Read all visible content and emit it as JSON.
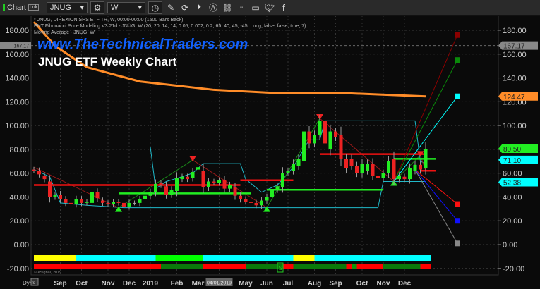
{
  "toolbar": {
    "window_title": "Chart",
    "link_badge": "Lnk",
    "symbol": "JNUG",
    "interval": "W",
    "icons": [
      "settings-icon",
      "clock-icon",
      "pencil-icon",
      "refresh-icon",
      "play-icon",
      "alert-icon",
      "link-icon",
      "options-icon",
      "chat-icon",
      "twitter-icon",
      "facebook-icon"
    ]
  },
  "header": {
    "line1": "* JNUG, DIREXION SHS ETF TR, W, 00:00-00:00 (1500 Bars Back)",
    "line2": "ENT Fibonacci Price Modeling V3.21d - JNUG, W (20, 20, 14, 14, 0.05, 0.002, 0.2, 65, 40, 45, -45, Long, false, false, true, 7)",
    "line3": "Moving Average - JNUG, W",
    "watermark": "www.TheTechnicalTraders.com",
    "title": "JNUG ETF Weekly Chart",
    "copyright": "© eSignal, 2019"
  },
  "colors": {
    "background": "#0a0a0a",
    "up_candle": "#22ee22",
    "down_candle": "#ee2222",
    "moving_average": "#ff8c28",
    "band": "#20b8c8",
    "support": "#22ee22",
    "resistance": "#ee1111"
  },
  "chart_data": {
    "type": "candlestick",
    "interval": "W",
    "first_week": "2018-07-30",
    "ylim": [
      -25,
      190
    ],
    "yticks": [
      180,
      160,
      140,
      120,
      100,
      80,
      60,
      40,
      20,
      0,
      -20
    ],
    "ytick_labels": [
      "180.00",
      "160.00",
      "140.00",
      "120.00",
      "100.00",
      "80.00",
      "60.00",
      "40.00",
      "20.00",
      "0.00",
      "-20.00"
    ],
    "grid": true,
    "xticks": [
      {
        "date": "2018-09-03",
        "label": "Sep"
      },
      {
        "date": "2018-10-01",
        "label": "Oct"
      },
      {
        "date": "2018-11-05",
        "label": "Nov"
      },
      {
        "date": "2018-12-03",
        "label": "Dec"
      },
      {
        "date": "2018-12-31",
        "label": "2019"
      },
      {
        "date": "2019-02-04",
        "label": "Feb"
      },
      {
        "date": "2019-03-04",
        "label": "Mar"
      },
      {
        "date": "2019-04-01",
        "label": "04/01/2019",
        "highlight": true
      },
      {
        "date": "2019-05-06",
        "label": "May"
      },
      {
        "date": "2019-06-03",
        "label": "Jun"
      },
      {
        "date": "2019-07-01",
        "label": "Jul"
      },
      {
        "date": "2019-08-05",
        "label": "Aug"
      },
      {
        "date": "2019-09-02",
        "label": "Sep"
      },
      {
        "date": "2019-10-07",
        "label": "Oct"
      },
      {
        "date": "2019-11-04",
        "label": "Nov"
      },
      {
        "date": "2019-12-02",
        "label": "Dec"
      }
    ],
    "x_axis_extra": {
      "dyn_label": "Dyn",
      "toggle_label": "fs"
    },
    "candles_open_close": [
      [
        63,
        62
      ],
      [
        62,
        59
      ],
      [
        58,
        55
      ],
      [
        53,
        40
      ],
      [
        40,
        42
      ],
      [
        42,
        38
      ],
      [
        38,
        35
      ],
      [
        35,
        34
      ],
      [
        34,
        38
      ],
      [
        38,
        35
      ],
      [
        35,
        36
      ],
      [
        35,
        44
      ],
      [
        44,
        39
      ],
      [
        37,
        35
      ],
      [
        35,
        34
      ],
      [
        34,
        36
      ],
      [
        36,
        35
      ],
      [
        35,
        32
      ],
      [
        32,
        35
      ],
      [
        35,
        35
      ],
      [
        35,
        38
      ],
      [
        38,
        41
      ],
      [
        41,
        44
      ],
      [
        44,
        51
      ],
      [
        52,
        50
      ],
      [
        49,
        42
      ],
      [
        42,
        46
      ],
      [
        45,
        56
      ],
      [
        55,
        57
      ],
      [
        57,
        55
      ],
      [
        56,
        61
      ],
      [
        63,
        65
      ],
      [
        62,
        48
      ],
      [
        48,
        53
      ],
      [
        53,
        52
      ],
      [
        52,
        54
      ],
      [
        54,
        47
      ],
      [
        47,
        50
      ],
      [
        48,
        41
      ],
      [
        41,
        38
      ],
      [
        38,
        36
      ],
      [
        36,
        35
      ],
      [
        35,
        33
      ],
      [
        33,
        37
      ],
      [
        37,
        40
      ],
      [
        40,
        46
      ],
      [
        46,
        49
      ],
      [
        48,
        60
      ],
      [
        60,
        62
      ],
      [
        62,
        68
      ],
      [
        66,
        72
      ],
      [
        70,
        95
      ],
      [
        95,
        85
      ],
      [
        85,
        92
      ],
      [
        92,
        104
      ],
      [
        104,
        85
      ],
      [
        80,
        95
      ],
      [
        95,
        90
      ],
      [
        92,
        72
      ],
      [
        72,
        64
      ],
      [
        72,
        66
      ],
      [
        66,
        60
      ],
      [
        60,
        68
      ],
      [
        62,
        68
      ],
      [
        68,
        58
      ],
      [
        58,
        56
      ],
      [
        56,
        60
      ],
      [
        60,
        70
      ],
      [
        72,
        55
      ],
      [
        55,
        58
      ],
      [
        57,
        55
      ],
      [
        55,
        64
      ],
      [
        62,
        67
      ],
      [
        67,
        63
      ],
      [
        64,
        80
      ]
    ],
    "moving_average": [
      [
        "2018-07-30",
        187
      ],
      [
        "2018-08-27",
        167
      ],
      [
        "2018-10-08",
        149
      ],
      [
        "2018-12-17",
        137
      ],
      [
        "2019-03-25",
        130
      ],
      [
        "2019-06-24",
        127
      ],
      [
        "2019-09-23",
        127
      ],
      [
        "2019-12-30",
        124.5
      ]
    ],
    "zigzag": [
      [
        "2018-07-30",
        65
      ],
      [
        "2018-11-19",
        31
      ],
      [
        "2019-02-25",
        71
      ],
      [
        "2019-06-03",
        31
      ],
      [
        "2019-08-12",
        106
      ],
      [
        "2019-11-18",
        53
      ],
      [
        "2019-12-23",
        75
      ],
      [
        "2019-12-30",
        62
      ]
    ],
    "pivot_lows": [
      [
        "2018-11-19",
        31
      ],
      [
        "2019-06-03",
        31
      ],
      [
        "2019-11-18",
        53
      ]
    ],
    "pivot_highs": [
      [
        "2019-02-25",
        71
      ],
      [
        "2019-08-12",
        106
      ],
      [
        "2019-12-23",
        75
      ]
    ],
    "bands": [
      [
        [
          "2018-07-30",
          82
        ],
        [
          "2018-12-31",
          82
        ],
        [
          "2019-01-07",
          47
        ],
        [
          "2019-01-21",
          53
        ],
        [
          "2019-02-11",
          57
        ],
        [
          "2019-02-25",
          60
        ],
        [
          "2019-03-11",
          68
        ],
        [
          "2019-04-29",
          68
        ],
        [
          "2019-05-06",
          55
        ],
        [
          "2019-05-27",
          44
        ],
        [
          "2019-06-17",
          50
        ],
        [
          "2019-07-08",
          65
        ],
        [
          "2019-07-29",
          88
        ],
        [
          "2019-08-12",
          88
        ],
        [
          "2019-08-19",
          104
        ],
        [
          "2019-12-16",
          104
        ],
        [
          "2019-12-23",
          70
        ],
        [
          "2019-12-30",
          68
        ]
      ],
      [
        [
          "2018-07-30",
          63
        ],
        [
          "2018-08-20",
          57
        ],
        [
          "2018-09-03",
          35
        ],
        [
          "2018-10-08",
          33
        ],
        [
          "2018-11-26",
          31
        ],
        [
          "2019-06-03",
          31
        ],
        [
          "2019-10-28",
          31
        ],
        [
          "2019-11-04",
          53
        ],
        [
          "2019-12-30",
          53
        ]
      ]
    ],
    "resistance_levels": [
      [
        [
          "2018-07-30",
          50
        ],
        [
          "2019-04-29",
          50
        ]
      ],
      [
        [
          "2019-04-29",
          54
        ],
        [
          "2019-07-08",
          54
        ]
      ],
      [
        [
          "2019-08-12",
          76
        ],
        [
          "2019-12-30",
          76
        ]
      ],
      [
        [
          "2019-12-23",
          62
        ],
        [
          "2020-01-13",
          62
        ]
      ]
    ],
    "support_levels": [
      [
        [
          "2018-11-19",
          43
        ],
        [
          "2019-05-13",
          43
        ]
      ],
      [
        [
          "2019-06-03",
          46
        ],
        [
          "2019-11-04",
          46
        ]
      ],
      [
        [
          "2019-11-18",
          72
        ],
        [
          "2020-01-13",
          72
        ]
      ]
    ],
    "fib_targets": [
      {
        "from": [
          "2019-11-18",
          53
        ],
        "to": [
          "2020-02-10",
          176
        ],
        "color": "#8b0000"
      },
      {
        "from": [
          "2019-11-18",
          53
        ],
        "to": [
          "2020-02-10",
          155
        ],
        "color": "#0a8a0a"
      },
      {
        "from": [
          "2019-11-18",
          53
        ],
        "to": [
          "2020-02-10",
          124.5
        ],
        "color": "#00ffff"
      },
      {
        "from": [
          "2019-12-16",
          63
        ],
        "to": [
          "2020-02-10",
          34
        ],
        "color": "#ff1010"
      },
      {
        "from": [
          "2019-12-16",
          63
        ],
        "to": [
          "2020-02-10",
          20
        ],
        "color": "#1010ff"
      },
      {
        "from": [
          "2019-12-16",
          63
        ],
        "to": [
          "2020-02-10",
          1
        ],
        "color": "#888888"
      }
    ],
    "price_flags": [
      {
        "value": 167.17,
        "label": "167.17",
        "color": "#888888",
        "text": "#222"
      },
      {
        "value": 124.47,
        "label": "124.47",
        "color": "#ff8c28",
        "text": "#222"
      },
      {
        "value": 80.5,
        "label": "80.50",
        "color": "#22ee22",
        "text": "#222"
      },
      {
        "value": 71.1,
        "label": "71.10",
        "color": "#00ffff",
        "text": "#222"
      },
      {
        "value": 52.38,
        "label": "52.38",
        "color": "#00ffff",
        "text": "#222"
      }
    ],
    "trend_bar_top": [
      {
        "from": "2018-07-30",
        "to": "2018-09-24",
        "color": "#ffff00"
      },
      {
        "from": "2018-09-24",
        "to": "2019-01-07",
        "color": "#00ffff"
      },
      {
        "from": "2019-01-07",
        "to": "2019-03-11",
        "color": "#00ff00"
      },
      {
        "from": "2019-03-11",
        "to": "2019-07-08",
        "color": "#00ffff"
      },
      {
        "from": "2019-07-08",
        "to": "2019-08-05",
        "color": "#ffff00"
      },
      {
        "from": "2019-08-05",
        "to": "2020-01-06",
        "color": "#00ffff"
      }
    ],
    "trend_bar_bottom": [
      {
        "from": "2018-07-30",
        "to": "2019-01-14",
        "color": "#ff0000"
      },
      {
        "from": "2019-01-14",
        "to": "2019-03-11",
        "color": "#0a7a0a"
      },
      {
        "from": "2019-03-11",
        "to": "2019-05-06",
        "color": "#ff0000"
      },
      {
        "from": "2019-05-06",
        "to": "2019-06-24",
        "color": "#0a7a0a"
      },
      {
        "from": "2019-06-24",
        "to": "2019-07-08",
        "color": "#ff0000"
      },
      {
        "from": "2019-07-08",
        "to": "2019-09-16",
        "color": "#0a7a0a"
      },
      {
        "from": "2019-09-16",
        "to": "2019-09-23",
        "color": "#ff0000"
      },
      {
        "from": "2019-09-23",
        "to": "2019-09-30",
        "color": "#0a9a0a"
      },
      {
        "from": "2019-09-30",
        "to": "2019-11-04",
        "color": "#ff0000"
      },
      {
        "from": "2019-11-04",
        "to": "2019-12-23",
        "color": "#0a7a0a"
      },
      {
        "from": "2019-12-23",
        "to": "2020-01-06",
        "color": "#ff0000"
      }
    ],
    "signal_marker": {
      "date": "2019-06-17",
      "label": "S"
    }
  }
}
